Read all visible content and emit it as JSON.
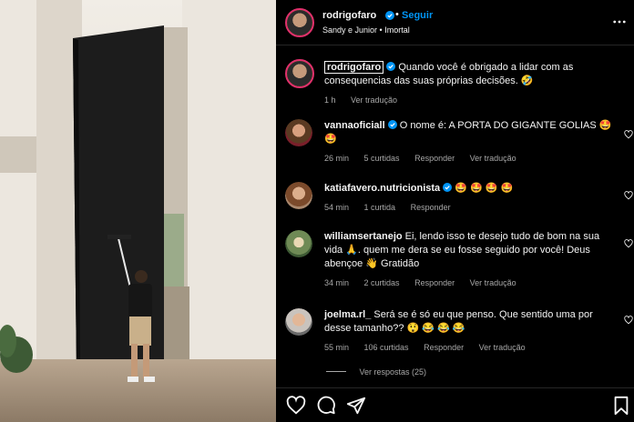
{
  "post": {
    "author": "rodrigofaro",
    "follow_label": "Seguir",
    "location": "Sandy e Junior • Imortal"
  },
  "caption": {
    "author": "rodrigofaro",
    "text": "Quando você é obrigado a lidar com as consequencias das suas próprias decisões. 🤣",
    "time": "1 h",
    "see_translation": "Ver tradução"
  },
  "comments": [
    {
      "user": "vannaoficiall",
      "verified": true,
      "text": "O nome é: A PORTA DO GIGANTE GOLIAS 🤩 🤩",
      "time": "26 min",
      "likes": "5 curtidas",
      "reply": "Responder",
      "translate": "Ver tradução"
    },
    {
      "user": "katiafavero.nutricionista",
      "verified": true,
      "text": "🤩 🤩 🤩 🤩",
      "time": "54 min",
      "likes": "1 curtida",
      "reply": "Responder",
      "translate": ""
    },
    {
      "user": "williamsertanejo",
      "verified": false,
      "text": "Ei, lendo isso te desejo tudo de bom na sua vida 🙏. quem me dera se eu fosse seguido por você! Deus abençoe 👋 Gratidão",
      "time": "34 min",
      "likes": "2 curtidas",
      "reply": "Responder",
      "translate": "Ver tradução"
    },
    {
      "user": "joelma.rl_",
      "verified": false,
      "text": "Será se é só eu que penso. Que sentido uma por desse tamanho?? 😲 😂 😂 😂",
      "time": "55 min",
      "likes": "106 curtidas",
      "reply": "Responder",
      "translate": "Ver tradução"
    }
  ],
  "view_replies": "Ver respostas (25)",
  "icons": {
    "more": "more-options-icon",
    "like": "heart-icon",
    "comment": "comment-icon",
    "share": "share-icon",
    "save": "bookmark-icon"
  },
  "colors": {
    "accent": "#0095f6",
    "verified": "#0095f6",
    "muted": "#a8a8a8"
  }
}
